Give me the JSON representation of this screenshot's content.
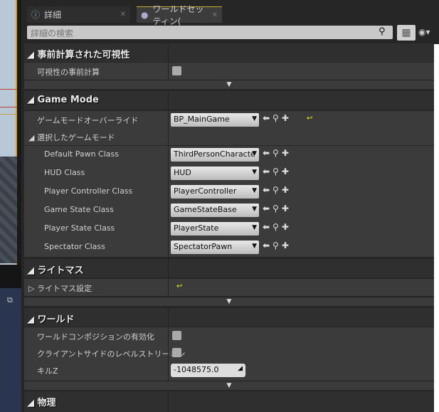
{
  "tabs": [
    {
      "label": "詳細",
      "icon": "info-icon"
    },
    {
      "label": "ワールドセッティン(",
      "icon": "globe-icon"
    }
  ],
  "search": {
    "placeholder": "詳細の検索"
  },
  "sections": {
    "precomputed": {
      "title": "事前計算された可視性",
      "rows": [
        {
          "label": "可視性の事前計算",
          "checked": false
        }
      ]
    },
    "gamemode": {
      "title": "Game Mode",
      "override_label": "ゲームモードオーバーライド",
      "override_value": "BP_MainGame",
      "group_label": "選択したゲームモード",
      "rows": [
        {
          "label": "Default Pawn Class",
          "value": "ThirdPersonCharacte"
        },
        {
          "label": "HUD Class",
          "value": "HUD"
        },
        {
          "label": "Player Controller Class",
          "value": "PlayerController"
        },
        {
          "label": "Game State Class",
          "value": "GameStateBase"
        },
        {
          "label": "Player State Class",
          "value": "PlayerState"
        },
        {
          "label": "Spectator Class",
          "value": "SpectatorPawn"
        }
      ]
    },
    "lightmass": {
      "title": "ライトマス",
      "rows": [
        {
          "label": "ライトマス設定"
        }
      ]
    },
    "world": {
      "title": "ワールド",
      "rows": [
        {
          "label": "ワールドコンポジションの有効化",
          "checked": false
        },
        {
          "label": "クライアントサイドのレベルストリーミン",
          "checked": false
        }
      ],
      "killz_label": "キルZ",
      "killz_value": "-1048575.0"
    },
    "physics": {
      "title": "物理"
    }
  },
  "colors": {
    "accent": "#c8a830",
    "reset": "#eeee00"
  }
}
